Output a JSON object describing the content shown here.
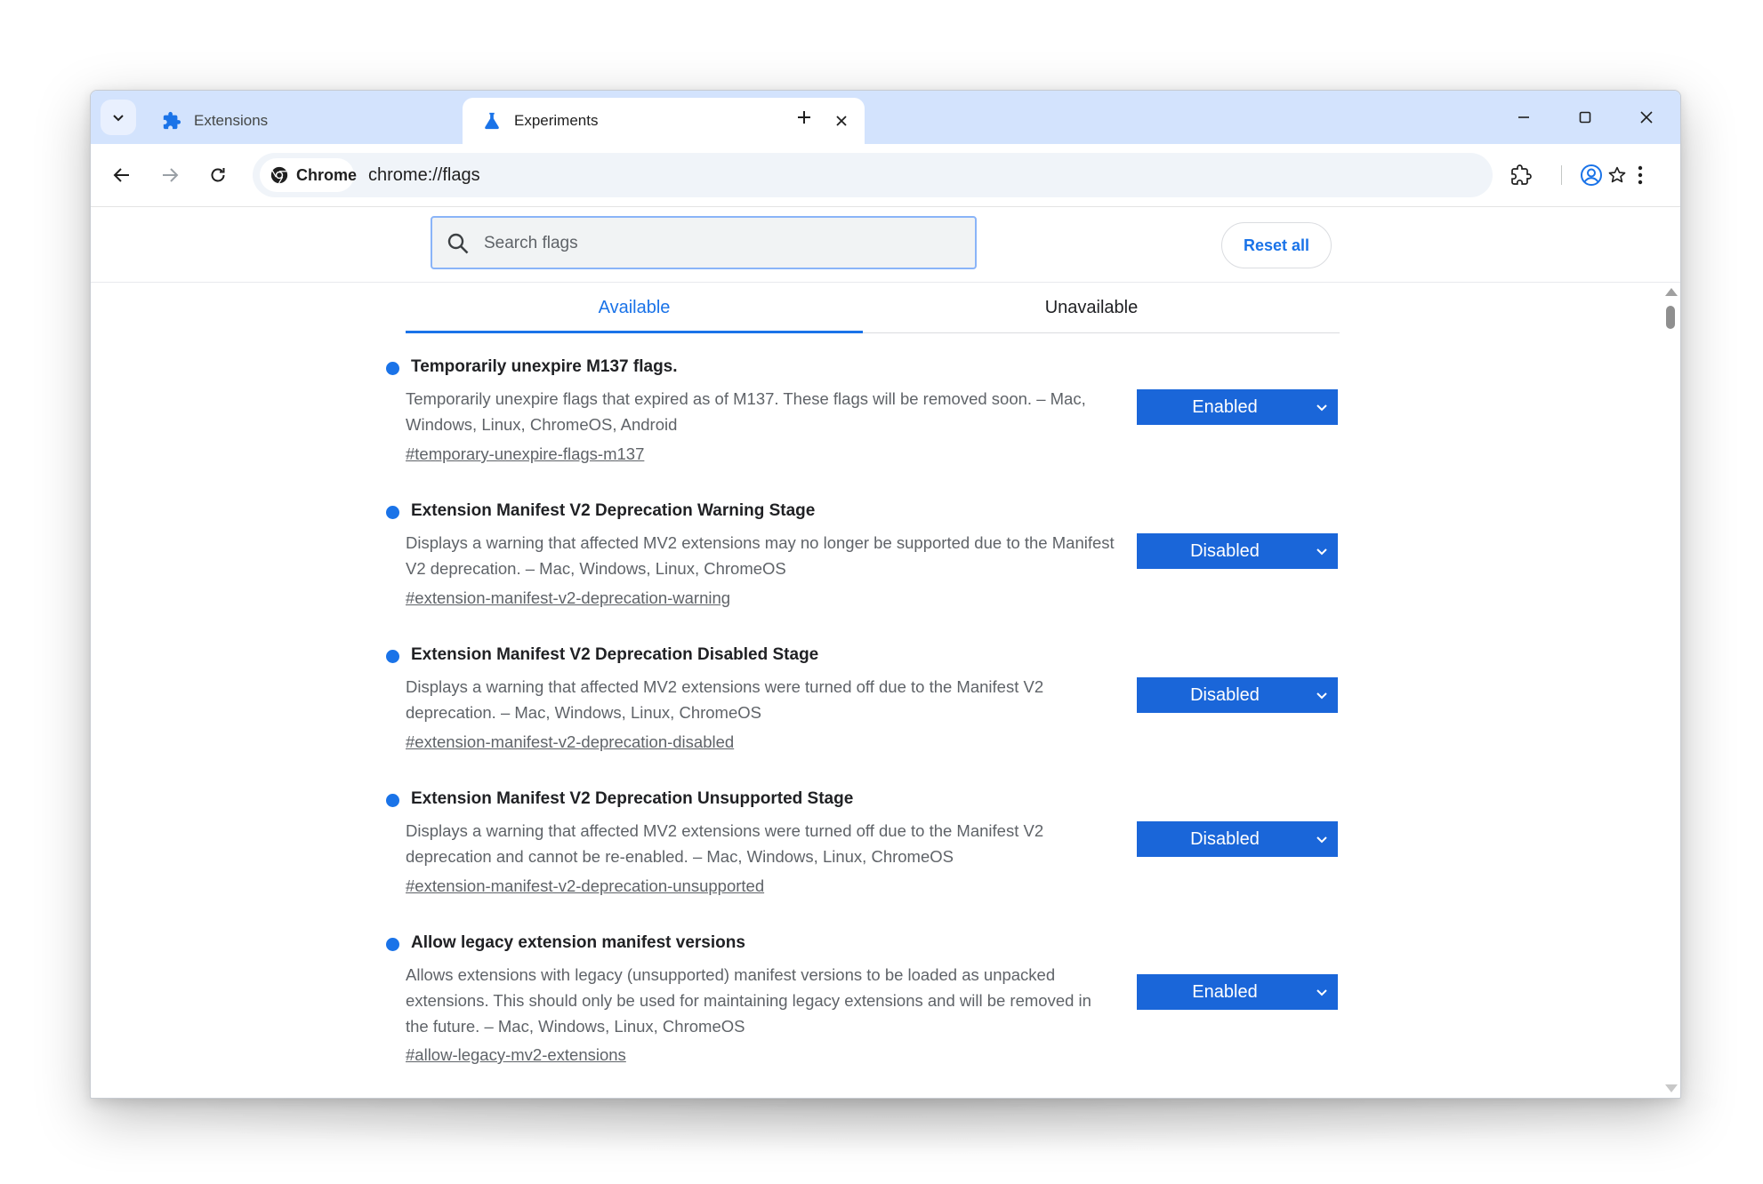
{
  "tabs": [
    {
      "title": "Extensions",
      "icon": "puzzle-icon",
      "active": false
    },
    {
      "title": "Experiments",
      "icon": "flask-icon",
      "active": true
    }
  ],
  "omnibox": {
    "chip_label": "Chrome",
    "url": "chrome://flags"
  },
  "flags_page": {
    "search_placeholder": "Search flags",
    "reset_label": "Reset all",
    "tab_available": "Available",
    "tab_unavailable": "Unavailable",
    "items": [
      {
        "name": "Temporarily unexpire M137 flags.",
        "description": "Temporarily unexpire flags that expired as of M137. These flags will be removed soon. – Mac, Windows, Linux, ChromeOS, Android",
        "link": "#temporary-unexpire-flags-m137",
        "value": "Enabled"
      },
      {
        "name": "Extension Manifest V2 Deprecation Warning Stage",
        "description": "Displays a warning that affected MV2 extensions may no longer be supported due to the Manifest V2 deprecation. – Mac, Windows, Linux, ChromeOS",
        "link": "#extension-manifest-v2-deprecation-warning",
        "value": "Disabled"
      },
      {
        "name": "Extension Manifest V2 Deprecation Disabled Stage",
        "description": "Displays a warning that affected MV2 extensions were turned off due to the Manifest V2 deprecation. – Mac, Windows, Linux, ChromeOS",
        "link": "#extension-manifest-v2-deprecation-disabled",
        "value": "Disabled"
      },
      {
        "name": "Extension Manifest V2 Deprecation Unsupported Stage",
        "description": "Displays a warning that affected MV2 extensions were turned off due to the Manifest V2 deprecation and cannot be re-enabled. – Mac, Windows, Linux, ChromeOS",
        "link": "#extension-manifest-v2-deprecation-unsupported",
        "value": "Disabled"
      },
      {
        "name": "Allow legacy extension manifest versions",
        "description": "Allows extensions with legacy (unsupported) manifest versions to be loaded as unpacked extensions. This should only be used for maintaining legacy extensions and will be removed in the future. – Mac, Windows, Linux, ChromeOS",
        "link": "#allow-legacy-mv2-extensions",
        "value": "Enabled"
      }
    ]
  },
  "colors": {
    "accent": "#1a73e8",
    "tabstrip": "#d3e3fd",
    "select_bg": "#1a66d9"
  }
}
